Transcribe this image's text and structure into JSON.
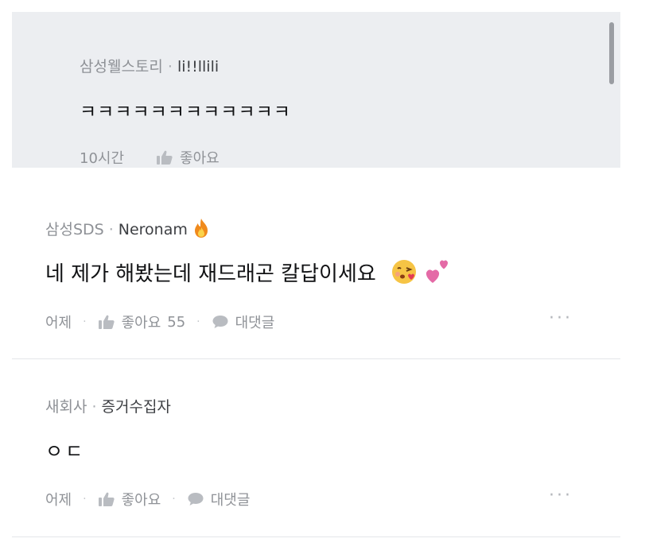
{
  "reply": {
    "company": "삼성웰스토리",
    "nickname": "li!!llili",
    "body": "ㅋㅋㅋㅋㅋㅋㅋㅋㅋㅋㅋㅋ",
    "time": "10시간",
    "like_label": "좋아요"
  },
  "comments": [
    {
      "company": "삼성SDS",
      "nickname": "Neronam",
      "badge_icon": "fire-icon",
      "body": "네 제가 해봤는데 재드래곤 칼답이세요",
      "emojis": [
        "blowing-kiss-icon",
        "two-hearts-icon"
      ],
      "time": "어제",
      "like_label": "좋아요",
      "like_count": "55",
      "reply_label": "대댓글",
      "more_label": "···"
    },
    {
      "company": "새회사",
      "nickname": "증거수집자",
      "body": "ㅇㄷ",
      "time": "어제",
      "like_label": "좋아요",
      "reply_label": "대댓글",
      "more_label": "···"
    }
  ],
  "colors": {
    "panel_bg": "#eceef1",
    "text_primary": "#111214",
    "text_secondary": "#8e9196",
    "divider": "#e4e6e9"
  }
}
